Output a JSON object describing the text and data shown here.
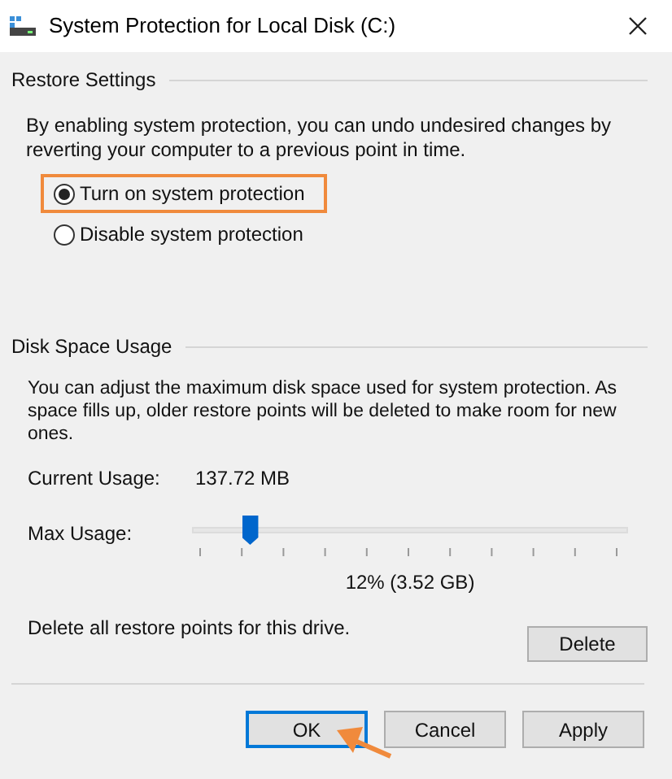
{
  "window": {
    "title": "System Protection for Local Disk (C:)"
  },
  "restore_settings": {
    "heading": "Restore Settings",
    "description": "By enabling system protection, you can undo undesired changes by reverting your computer to a previous point in time.",
    "options": [
      {
        "label": "Turn on system protection",
        "selected": true,
        "highlighted": true
      },
      {
        "label": "Disable system protection",
        "selected": false,
        "highlighted": false
      }
    ]
  },
  "disk_space_usage": {
    "heading": "Disk Space Usage",
    "description": "You can adjust the maximum disk space used for system protection. As space fills up, older restore points will be deleted to make room for new ones.",
    "current_usage_label": "Current Usage:",
    "current_usage_value": "137.72 MB",
    "max_usage_label": "Max Usage:",
    "max_usage": {
      "level": 0.12,
      "reading": "12% (3.52 GB)"
    },
    "delete_text": "Delete all restore points for this drive.",
    "delete_button": "Delete"
  },
  "buttons": [
    {
      "label": "OK",
      "default": true,
      "pointed_at": true
    },
    {
      "label": "Cancel",
      "default": false,
      "pointed_at": false
    },
    {
      "label": "Apply",
      "default": false,
      "pointed_at": false
    }
  ]
}
